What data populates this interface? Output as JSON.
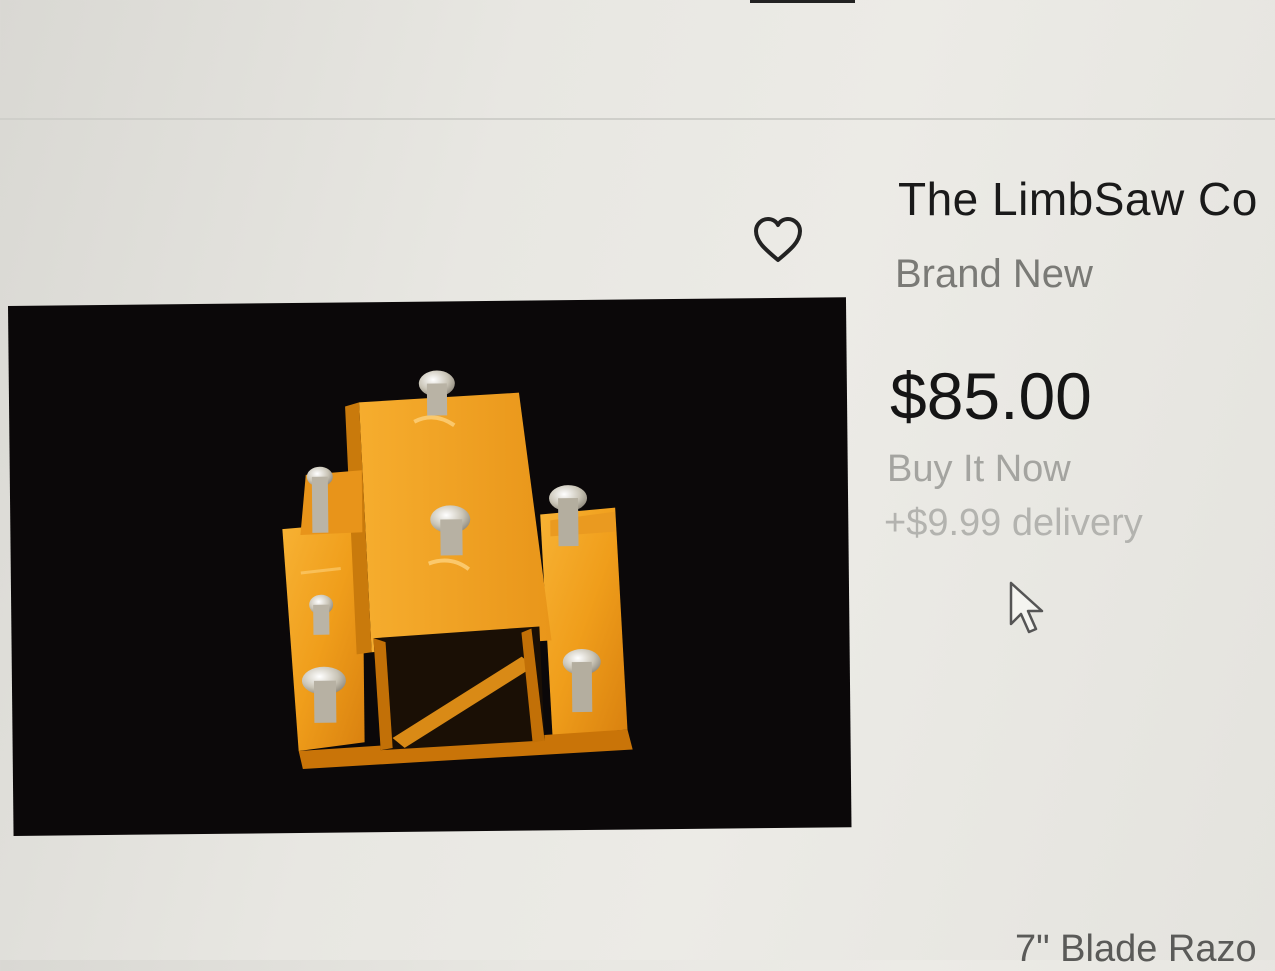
{
  "listing": {
    "title": "The LimbSaw Co",
    "condition": "Brand New",
    "price": "$85.00",
    "buy_format": "Buy It Now",
    "delivery": "+$9.99 delivery",
    "watch_icon": "heart-icon",
    "image_subject": "orange metal bracket with bolts"
  },
  "next_listing": {
    "title_partial": "7\" Blade Razo"
  },
  "colors": {
    "background": "#e8e7e2",
    "text_primary": "#1a1a1a",
    "text_secondary": "#7a7a76",
    "text_muted": "#b3b3af",
    "image_background": "#0b0809",
    "product_orange": "#f0a01e"
  }
}
